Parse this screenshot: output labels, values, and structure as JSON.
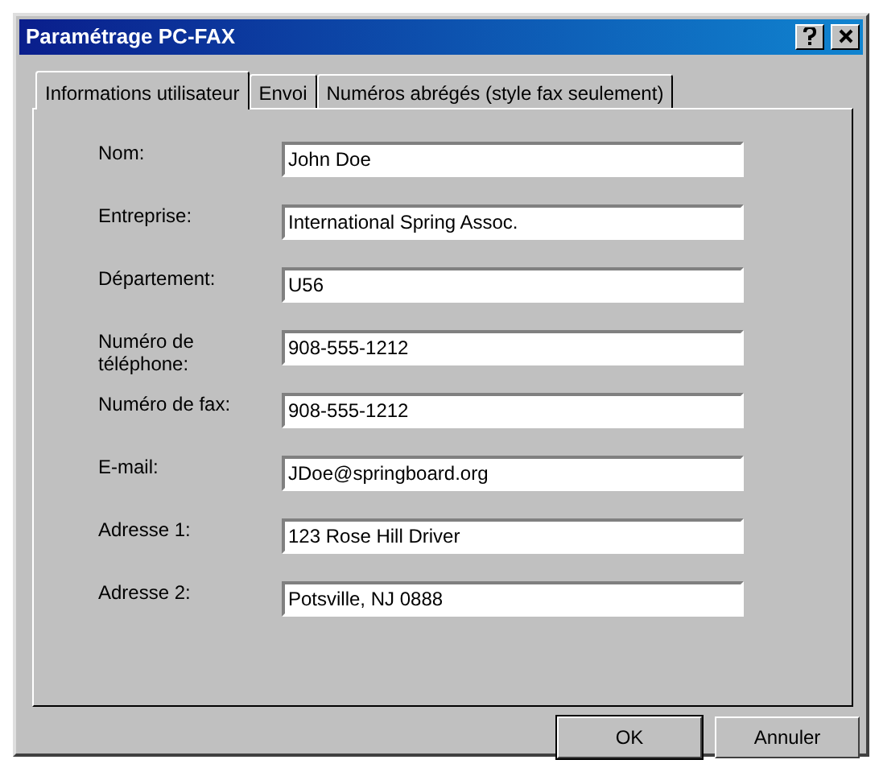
{
  "window": {
    "title": "Paramétrage PC-FAX"
  },
  "tabs": [
    {
      "label": "Informations utilisateur",
      "selected": true
    },
    {
      "label": "Envoi",
      "selected": false
    },
    {
      "label": "Numéros abrégés (style fax seulement)",
      "selected": false
    }
  ],
  "fields": [
    {
      "label": "Nom:",
      "value": "John Doe"
    },
    {
      "label": "Entreprise:",
      "value": "International Spring Assoc."
    },
    {
      "label": "Département:",
      "value": "U56"
    },
    {
      "label": "Numéro de téléphone:",
      "value": "908-555-1212"
    },
    {
      "label": "Numéro de fax:",
      "value": "908-555-1212"
    },
    {
      "label": "E-mail:",
      "value": "JDoe@springboard.org"
    },
    {
      "label": "Adresse 1:",
      "value": "123 Rose Hill Driver"
    },
    {
      "label": "Adresse 2:",
      "value": "Potsville, NJ 0888"
    }
  ],
  "buttons": [
    {
      "label": "OK",
      "default": true
    },
    {
      "label": "Annuler",
      "default": false
    }
  ]
}
